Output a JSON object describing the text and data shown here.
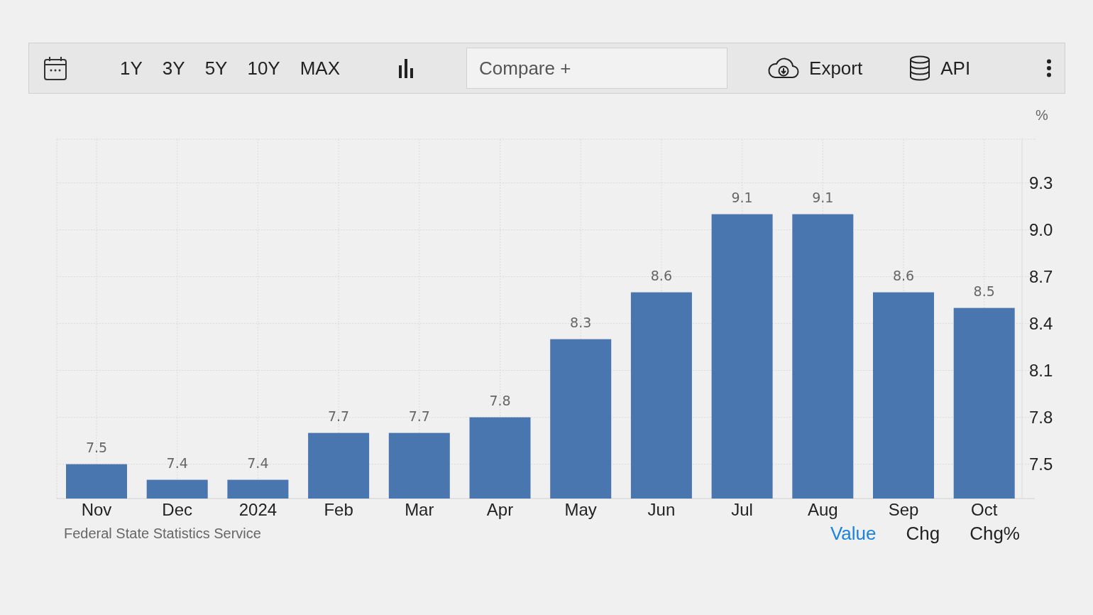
{
  "toolbar": {
    "ranges": [
      "1Y",
      "3Y",
      "5Y",
      "10Y",
      "MAX"
    ],
    "compare": {
      "placeholder": "Compare +"
    },
    "export": "Export",
    "api": "API"
  },
  "chart": {
    "unit": "%",
    "chart_data": {
      "type": "bar",
      "categories": [
        "Nov",
        "Dec",
        "2024",
        "Feb",
        "Mar",
        "Apr",
        "May",
        "Jun",
        "Jul",
        "Aug",
        "Sep",
        "Oct"
      ],
      "values": [
        7.5,
        7.4,
        7.4,
        7.7,
        7.7,
        7.8,
        8.3,
        8.6,
        9.1,
        9.1,
        8.6,
        8.5
      ],
      "ylim": [
        7.28,
        9.58
      ],
      "yticks": [
        7.5,
        7.8,
        8.1,
        8.4,
        8.7,
        {
          "value": 9,
          "label": "9.0"
        },
        9.3
      ],
      "data_labels": true,
      "grid": true
    }
  },
  "footer": {
    "source": "Federal State Statistics Service",
    "views": [
      {
        "label": "Value",
        "selected": true
      },
      {
        "label": "Chg",
        "selected": false
      },
      {
        "label": "Chg%",
        "selected": false
      }
    ]
  }
}
